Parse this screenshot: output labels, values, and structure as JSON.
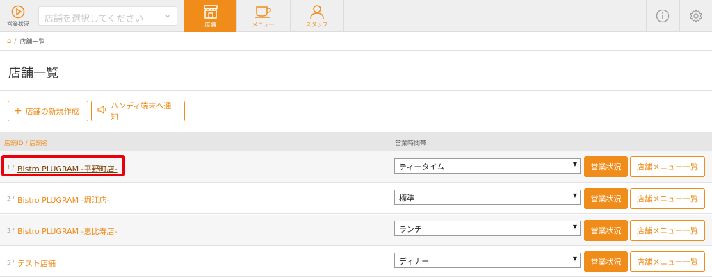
{
  "topbar": {
    "status_label": "営業状況",
    "store_select_placeholder": "店舗を選択してください",
    "tabs": [
      {
        "label": "店舗",
        "icon": "store-icon",
        "active": true
      },
      {
        "label": "メニュー",
        "icon": "cup-icon",
        "active": false
      },
      {
        "label": "スタッフ",
        "icon": "staff-icon",
        "active": false
      }
    ],
    "info_icon": "info-icon",
    "settings_icon": "gear-icon"
  },
  "breadcrumb": {
    "sep": "/",
    "current": "店舗一覧"
  },
  "page": {
    "title": "店舗一覧"
  },
  "actions": {
    "new_store": "店舗の新規作成",
    "notify_handy": "ハンディ端末へ通知"
  },
  "table": {
    "col_store": "店舗ID / 店舗名",
    "col_time": "営業時間帯",
    "rows": [
      {
        "id": "1 /",
        "name": "Bistro PLUGRAM -平野町店-",
        "time": "ティータイム",
        "status_btn": "営業状況",
        "menu_btn": "店舗メニュー一覧"
      },
      {
        "id": "2 /",
        "name": "Bistro PLUGRAM -堀江店-",
        "time": "標準",
        "status_btn": "営業状況",
        "menu_btn": "店舗メニュー一覧"
      },
      {
        "id": "3 /",
        "name": "Bistro PLUGRAM -恵比寿店-",
        "time": "ランチ",
        "status_btn": "営業状況",
        "menu_btn": "店舗メニュー一覧"
      },
      {
        "id": "5 /",
        "name": "テスト店舗",
        "time": "ディナー",
        "status_btn": "営業状況",
        "menu_btn": "店舗メニュー一覧"
      }
    ]
  },
  "colors": {
    "accent": "#ef8c1a",
    "highlight": "#e8000a"
  }
}
